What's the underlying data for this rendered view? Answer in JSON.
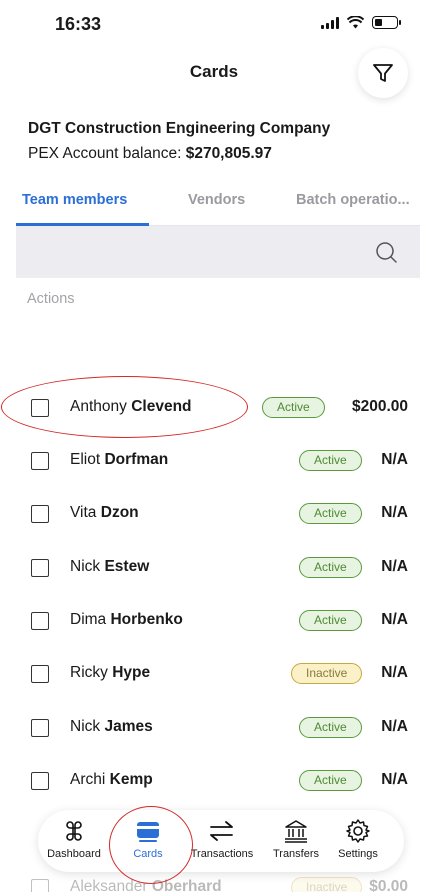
{
  "status": {
    "time": "16:33"
  },
  "header": {
    "title": "Cards",
    "filter_icon": "filter-icon"
  },
  "account": {
    "company": "DGT Construction Engineering Company",
    "balance_label": "PEX Account balance:",
    "balance_value": "$270,805.97"
  },
  "tabs": [
    {
      "label": "Team members",
      "active": true
    },
    {
      "label": "Vendors",
      "active": false
    },
    {
      "label": "Batch operatio...",
      "active": false
    }
  ],
  "search": {
    "icon": "search-icon"
  },
  "actions_label": "Actions",
  "members": [
    {
      "first": "Anthony",
      "last": "Clevend",
      "status": "Active",
      "amount": "$200.00"
    },
    {
      "first": "Eliot",
      "last": "Dorfman",
      "status": "Active",
      "amount": "N/A"
    },
    {
      "first": "Vita",
      "last": "Dzon",
      "status": "Active",
      "amount": "N/A"
    },
    {
      "first": "Nick",
      "last": "Estew",
      "status": "Active",
      "amount": "N/A"
    },
    {
      "first": "Dima",
      "last": "Horbenko",
      "status": "Active",
      "amount": "N/A"
    },
    {
      "first": "Ricky",
      "last": "Hype",
      "status": "Inactive",
      "amount": "N/A"
    },
    {
      "first": "Nick",
      "last": "James",
      "status": "Active",
      "amount": "N/A"
    },
    {
      "first": "Archi",
      "last": "Kemp",
      "status": "Active",
      "amount": "N/A"
    },
    {
      "first": "Aleksander",
      "last": "Oberhard",
      "status": "Inactive",
      "amount": "$0.00"
    }
  ],
  "nav": [
    {
      "label": "Dashboard",
      "icon": "dashboard-icon",
      "active": false
    },
    {
      "label": "Cards",
      "icon": "cards-icon",
      "active": true
    },
    {
      "label": "Transactions",
      "icon": "transactions-icon",
      "active": false
    },
    {
      "label": "Transfers",
      "icon": "transfers-icon",
      "active": false
    },
    {
      "label": "Settings",
      "icon": "settings-icon",
      "active": false
    }
  ],
  "colors": {
    "accent": "#2b6fd6",
    "active_badge": "#e7f4e1",
    "inactive_badge": "#fbf1c8",
    "annotation": "#d42a2a"
  }
}
